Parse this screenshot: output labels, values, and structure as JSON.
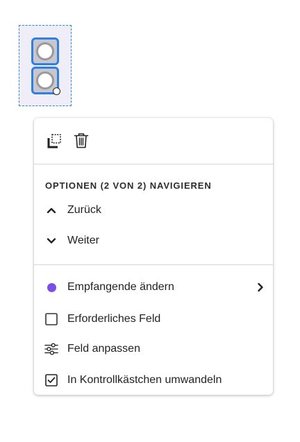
{
  "colors": {
    "selection_blue": "#2f80e3",
    "recipient_purple": "#7b4fe6",
    "field_background": "#efeef8"
  },
  "toolbar": {
    "duplicate_icon": "duplicate-icon",
    "delete_icon": "trash-icon"
  },
  "menu": {
    "section_heading": "OPTIONEN (2 VON 2) NAVIGIEREN",
    "back_label": "Zurück",
    "next_label": "Weiter",
    "recipient_label": "Empfangende ändern",
    "required_label": "Erforderliches Feld",
    "adjust_label": "Feld anpassen",
    "convert_label": "In Kontrollkästchen umwandeln"
  }
}
